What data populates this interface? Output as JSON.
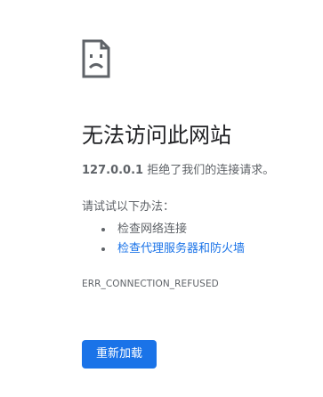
{
  "error_page": {
    "icon": "sad-page-icon",
    "title": "无法访问此网站",
    "host": "127.0.0.1",
    "summary_text": " 拒绝了我们的连接请求。",
    "suggestions_heading": "请试试以下办法：",
    "suggestions": [
      {
        "label": "检查网络连接",
        "is_link": false
      },
      {
        "label": "检查代理服务器和防火墙",
        "is_link": true
      }
    ],
    "error_code": "ERR_CONNECTION_REFUSED",
    "reload_button": "重新加载"
  },
  "colors": {
    "text_primary": "#202124",
    "text_secondary": "#5f6368",
    "link": "#1a73e8",
    "button_bg": "#1a73e8",
    "button_text": "#ffffff",
    "background": "#ffffff"
  }
}
